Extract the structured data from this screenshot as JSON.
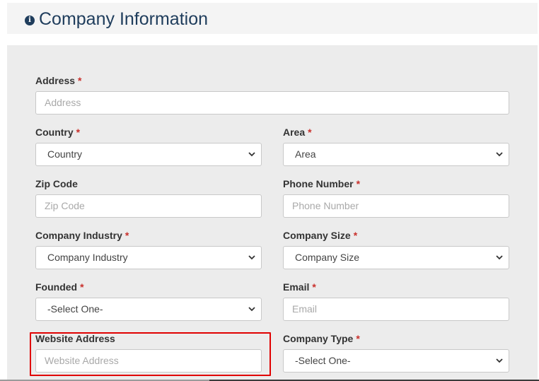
{
  "header": {
    "title": "Company Information",
    "icon": "info-icon"
  },
  "form": {
    "required_mark": "*",
    "address": {
      "label": "Address",
      "placeholder": "Address",
      "required": true
    },
    "country": {
      "label": "Country",
      "value": "Country",
      "required": true
    },
    "area": {
      "label": "Area",
      "value": "Area",
      "required": true
    },
    "zip_code": {
      "label": "Zip Code",
      "placeholder": "Zip Code",
      "required": false
    },
    "phone_number": {
      "label": "Phone Number",
      "placeholder": "Phone Number",
      "required": true
    },
    "company_industry": {
      "label": "Company Industry",
      "value": "Company Industry",
      "required": true
    },
    "company_size": {
      "label": "Company Size",
      "value": "Company Size",
      "required": true
    },
    "founded": {
      "label": "Founded",
      "value": "-Select One-",
      "required": true
    },
    "email": {
      "label": "Email",
      "placeholder": "Email",
      "required": true
    },
    "website_address": {
      "label": "Website Address",
      "placeholder": "Website Address",
      "required": false
    },
    "company_type": {
      "label": "Company Type",
      "value": "-Select One-",
      "required": true
    }
  },
  "colors": {
    "title": "#1f3d5c",
    "required": "#c9302c",
    "highlight": "#e00000",
    "panel": "#ececec"
  }
}
